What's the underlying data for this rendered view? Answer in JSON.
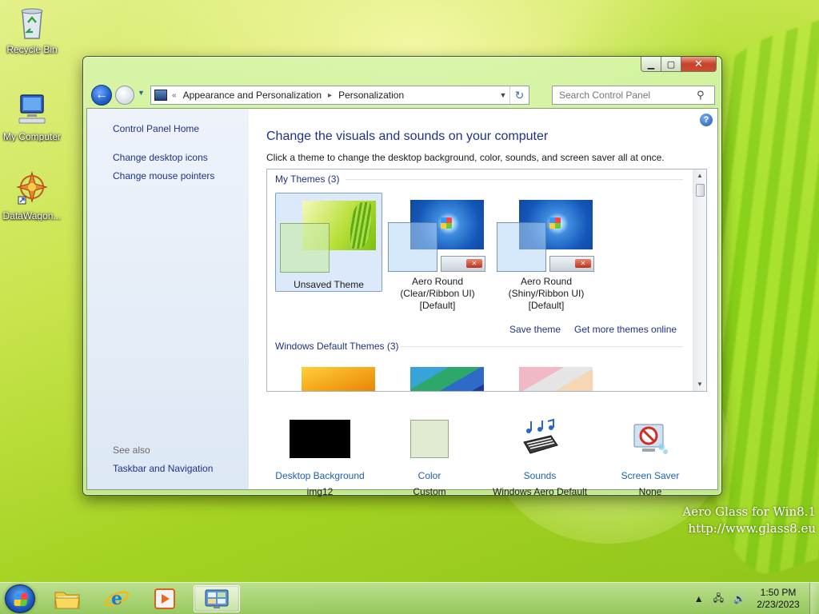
{
  "desktop": {
    "icons": [
      {
        "label": "Recycle Bin",
        "icon": "recycle-bin-icon"
      },
      {
        "label": "My Computer",
        "icon": "computer-icon"
      },
      {
        "label": "DataWagon...",
        "icon": "datawagon-icon"
      }
    ],
    "watermark": {
      "line1": "Aero Glass for Win8.1",
      "line2": "http://www.glass8.eu"
    }
  },
  "window": {
    "address": {
      "overflow": "«",
      "segments": [
        "Appearance and Personalization",
        "Personalization"
      ]
    },
    "search": {
      "placeholder": "Search Control Panel"
    },
    "left_pane": {
      "links": [
        "Control Panel Home",
        "Change desktop icons",
        "Change mouse pointers"
      ],
      "see_also_label": "See also",
      "see_also_links": [
        "Taskbar and Navigation"
      ]
    },
    "main": {
      "title": "Change the visuals and sounds on your computer",
      "description": "Click a theme to change the desktop background, color, sounds, and screen saver all at once.",
      "my_themes_header": "My Themes (3)",
      "themes": [
        {
          "name": "Unsaved Theme",
          "selected": true
        },
        {
          "name": "Aero Round (Clear/Ribbon UI) [Default]",
          "selected": false
        },
        {
          "name": "Aero Round (Shiny/Ribbon UI) [Default]",
          "selected": false
        }
      ],
      "theme_name_lines": [
        [
          "Unsaved Theme"
        ],
        [
          "Aero Round",
          "(Clear/Ribbon UI)",
          "[Default]"
        ],
        [
          "Aero Round",
          "(Shiny/Ribbon UI)",
          "[Default]"
        ]
      ],
      "save_theme": "Save theme",
      "get_more_themes": "Get more themes online",
      "default_themes_header": "Windows Default Themes (3)",
      "bottom": [
        {
          "label": "Desktop Background",
          "value": "img12",
          "icon": "desktop-background-icon"
        },
        {
          "label": "Color",
          "value": "Custom",
          "icon": "color-swatch-icon"
        },
        {
          "label": "Sounds",
          "value": "Windows Aero Default",
          "icon": "sounds-icon"
        },
        {
          "label": "Screen Saver",
          "value": "None",
          "icon": "screen-saver-icon"
        }
      ]
    }
  },
  "taskbar": {
    "time": "1:50 PM",
    "date": "2/23/2023",
    "apps": [
      "file-explorer-icon",
      "internet-explorer-icon",
      "media-player-icon",
      "control-panel-icon"
    ]
  },
  "colors": {
    "link": "#1e3287",
    "selected_theme": "#dbe9fb",
    "close_button": "#c7402a"
  }
}
